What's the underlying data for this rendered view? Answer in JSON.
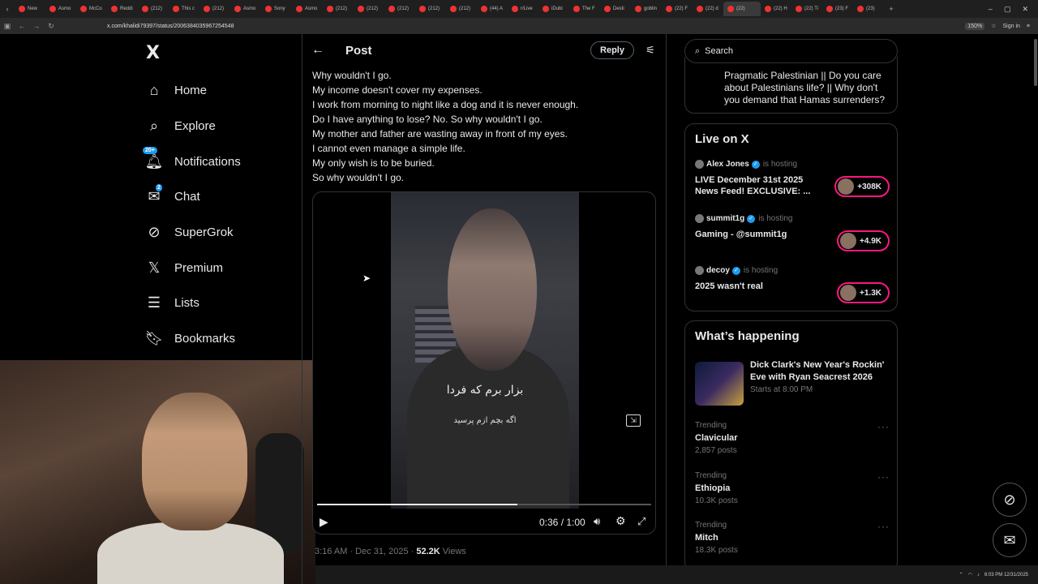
{
  "browser": {
    "tabs": [
      "New",
      "Asmo",
      "McCo",
      "Reddi",
      "(212)",
      "This c",
      "(212)",
      "Asmo",
      "Sony",
      "Asmo",
      "(212)",
      "(212)",
      "(212)",
      "(212)",
      "(212)",
      "(44) A",
      "r/Live",
      "iDubi",
      "The F",
      "Desti",
      "goblin",
      "(22) F",
      "(22) d",
      "(22)",
      "(22) H",
      "(22) Ti",
      "(23) F",
      "(23)"
    ],
    "url": "x.com/khalidi79397/status/2006384035967254548",
    "zoom": "150%",
    "sign_in": "Sign in"
  },
  "sidebar": {
    "logo": "X",
    "items": [
      {
        "label": "Home",
        "icon": "home-icon"
      },
      {
        "label": "Explore",
        "icon": "search-icon"
      },
      {
        "label": "Notifications",
        "icon": "bell-icon",
        "badge": "20+"
      },
      {
        "label": "Chat",
        "icon": "mail-icon",
        "badge": "2"
      },
      {
        "label": "SuperGrok",
        "icon": "grok-icon"
      },
      {
        "label": "Premium",
        "icon": "x-icon"
      },
      {
        "label": "Lists",
        "icon": "list-icon"
      },
      {
        "label": "Bookmarks",
        "icon": "bookmark-icon"
      }
    ]
  },
  "post": {
    "header_title": "Post",
    "reply_label": "Reply",
    "lines": [
      "Why wouldn't I go.",
      "My income doesn't cover my expenses.",
      "I work from morning to night like a dog and it is never enough.",
      "Do I have anything to lose? No. So why wouldn't I go.",
      "My mother and father are wasting away in front of my eyes.",
      "I cannot even manage a simple life.",
      "My only wish is to be buried.",
      "So why wouldn't I go."
    ],
    "video": {
      "subtitle_1": "بزار برم که فردا",
      "subtitle_2": "اگه بچم ازم پرسید",
      "time": "0:36 / 1:00",
      "progress": 0.6
    },
    "meta_time": "3:16 AM · Dec 31, 2025 · ",
    "views_count": "52.2K",
    "views_label": " Views"
  },
  "right": {
    "search_placeholder": "Search",
    "prev_text": "Pragmatic Palestinian || Do you care about Palestinians life? || Why don't you demand that Hamas surrenders?",
    "live_title": "Live on X",
    "live": [
      {
        "host": "Alex Jones",
        "status": "is hosting",
        "title": "LIVE December 31st 2025 News Feed! EXCLUSIVE: ...",
        "count": "+308K"
      },
      {
        "host": "summit1g",
        "status": "is hosting",
        "title": "Gaming - @summit1g",
        "count": "+4.9K"
      },
      {
        "host": "decoy",
        "status": "is hosting",
        "title": "2025 wasn't real",
        "count": "+1.3K"
      }
    ],
    "happening_title": "What’s happening",
    "happening_feature": {
      "title": "Dick Clark's New Year's Rockin' Eve with Ryan Seacrest 2026",
      "sub": "Starts at 8:00 PM"
    },
    "trends": [
      {
        "label": "Trending",
        "name": "Clavicular",
        "count": "2,857 posts"
      },
      {
        "label": "Trending",
        "name": "Ethiopia",
        "count": "10.3K posts"
      },
      {
        "label": "Trending",
        "name": "Mitch",
        "count": "18.3K posts"
      }
    ]
  },
  "taskbar": {
    "time": "6:03 PM",
    "date": "12/31/2025"
  },
  "colors": {
    "accent": "#1d9bf0",
    "live_ring": "#f91880",
    "muted": "#71767b",
    "border": "#2f3336"
  }
}
